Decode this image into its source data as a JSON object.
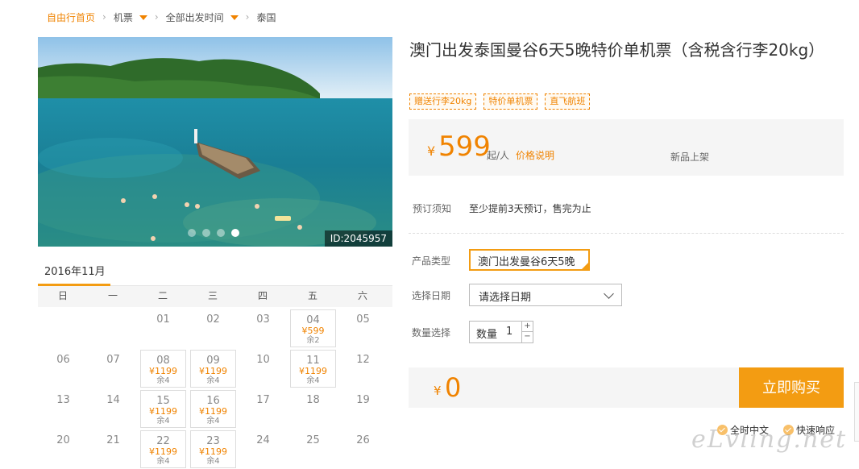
{
  "breadcrumb": {
    "home": "自由行首页",
    "category": "机票",
    "departure": "全部出发时间",
    "destination": "泰国"
  },
  "photo": {
    "id_label": "ID:2045957",
    "dots": 4,
    "active_dot": 4
  },
  "calendar": {
    "month": "2016年11月",
    "weekdays": [
      "日",
      "一",
      "二",
      "三",
      "四",
      "五",
      "六"
    ],
    "weeks": [
      [
        {
          "d": ""
        },
        {
          "d": ""
        },
        {
          "d": "01"
        },
        {
          "d": "02"
        },
        {
          "d": "03"
        },
        {
          "d": "04",
          "p": "¥599",
          "r": "余2"
        },
        {
          "d": "05"
        }
      ],
      [
        {
          "d": "06"
        },
        {
          "d": "07"
        },
        {
          "d": "08",
          "p": "¥1199",
          "r": "余4"
        },
        {
          "d": "09",
          "p": "¥1199",
          "r": "余4"
        },
        {
          "d": "10"
        },
        {
          "d": "11",
          "p": "¥1199",
          "r": "余4"
        },
        {
          "d": "12"
        }
      ],
      [
        {
          "d": "13"
        },
        {
          "d": "14"
        },
        {
          "d": "15",
          "p": "¥1199",
          "r": "余4"
        },
        {
          "d": "16",
          "p": "¥1199",
          "r": "余4"
        },
        {
          "d": "17"
        },
        {
          "d": "18"
        },
        {
          "d": "19"
        }
      ],
      [
        {
          "d": "20"
        },
        {
          "d": "21"
        },
        {
          "d": "22",
          "p": "¥1199",
          "r": "余4"
        },
        {
          "d": "23",
          "p": "¥1199",
          "r": "余4"
        },
        {
          "d": "24"
        },
        {
          "d": "25"
        },
        {
          "d": "26"
        }
      ]
    ]
  },
  "product": {
    "title": "澳门出发泰国曼谷6天5晚特价单机票（含税含行李20kg）",
    "tags": [
      "赠送行李20kg",
      "特价单机票",
      "直飞航班"
    ],
    "price_symbol": "¥",
    "price": "599",
    "price_unit": "起/人",
    "price_explain": "价格说明",
    "new_label": "新品上架"
  },
  "booking": {
    "notice_label": "预订须知",
    "notice_text": "至少提前3天预订，售完为止",
    "type_label": "产品类型",
    "type_value": "澳门出发曼谷6天5晚",
    "date_label": "选择日期",
    "date_placeholder": "请选择日期",
    "qty_label": "数量选择",
    "qty_prefix": "数量",
    "qty_value": "1",
    "qty_up": "+",
    "qty_down": "−",
    "total_symbol": "¥",
    "total": "0",
    "buy_label": "立即购买",
    "features": [
      "全时中文",
      "快速响应"
    ]
  },
  "watermark": "eLvling.net",
  "colors": {
    "accent": "#f08300",
    "button": "#f39c12",
    "panel": "#f5f5f5"
  }
}
